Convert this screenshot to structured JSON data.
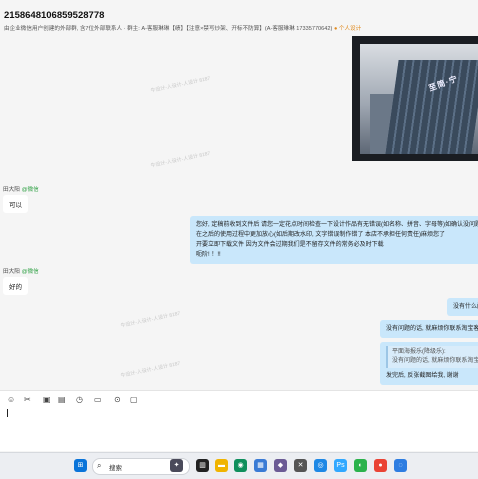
{
  "header": {
    "title": "2158648106859528778",
    "subtitle": "由企业微信用户创建的外部群, 含7位外部联系人 · 群主: A-客服琳琳【绩】【注意×禁写炒架、开标不防算】(A-客服琳琳 17335770642)",
    "subtitle_tag": "● 个人设计"
  },
  "watermarks": [
    "牛设计-人设计-人设计 8187",
    "牛设计-人设计-人设计 8187",
    "牛设计-人设计-人设计 8187",
    "牛设计-人设计-人设计 8187"
  ],
  "image_message": {
    "sign_text": "至简·宁"
  },
  "messages": {
    "m1": {
      "sender": "田大阳",
      "badge": "@微信",
      "text": "可以"
    },
    "m2": {
      "lines": [
        "您好, 定稿前收到文件后 请您一定花点时间检查一下设计作品有无错误(如名称、拼音、字母等)如确认没问题, 也",
        "在之后的使用过程中更加放心(如后期改水印, 文字错误制作错了 本店不承担任何责任)麻烦您了",
        "开要立即下载文件 因为文件会过期我们是不留存文件的常务必及时下载",
        "呃阶! ！!!"
      ]
    },
    "m3": {
      "sender": "田大阳",
      "badge": "@微信",
      "text": "好的"
    },
    "m4": {
      "text": "没有什么问"
    },
    "m5": {
      "text": "没有问题的话, 就麻烦你联系淘宝客服"
    },
    "m6": {
      "quote_author": "平面海报乐(降级乐):",
      "quote_text": "没有问题的话, 就麻烦你联系淘宝客服",
      "text": "发完后, 反张截图给我, 谢谢"
    }
  },
  "toolbar": {
    "icons": [
      "emoji-icon",
      "scissors-icon",
      "image-icon",
      "doc-icon",
      "history-icon",
      "folder-icon",
      "more-icon",
      "screen-icon"
    ]
  },
  "taskbar": {
    "search_label": "搜索"
  }
}
